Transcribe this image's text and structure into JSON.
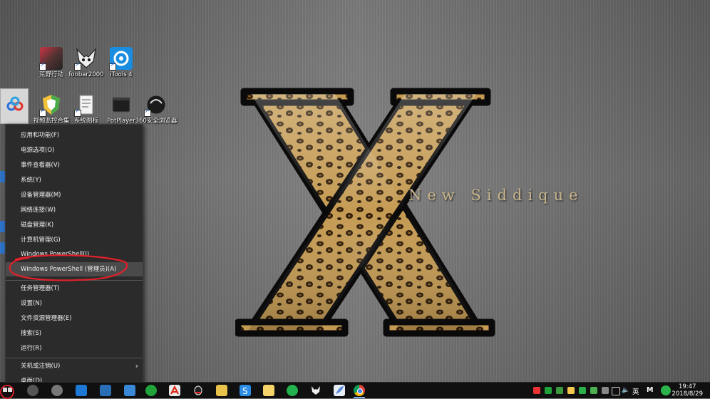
{
  "wallpaper": {
    "text": "New Siddique"
  },
  "desktop_icons": [
    {
      "label": "荒野行动",
      "icon": "game-icon"
    },
    {
      "label": "foobar2000",
      "icon": "foobar-icon"
    },
    {
      "label": "iTools 4",
      "icon": "itools-icon"
    },
    {
      "label": "视频监控合集",
      "icon": "shield-icon"
    },
    {
      "label": "系统图标",
      "icon": "document-icon"
    },
    {
      "label": "PotPlayer",
      "icon": "video-icon"
    },
    {
      "label": "360安全浏览器",
      "icon": "browser-icon"
    }
  ],
  "context_menu": {
    "items": [
      {
        "label": "应用和功能(F)"
      },
      {
        "label": "电源选项(O)"
      },
      {
        "label": "事件查看器(V)"
      },
      {
        "label": "系统(Y)"
      },
      {
        "label": "设备管理器(M)"
      },
      {
        "label": "网络连接(W)"
      },
      {
        "label": "磁盘管理(K)"
      },
      {
        "label": "计算机管理(G)"
      },
      {
        "label": "Windows PowerShell(I)"
      },
      {
        "label": "Windows PowerShell (管理员)(A)"
      },
      {
        "label": "任务管理器(T)"
      },
      {
        "label": "设置(N)"
      },
      {
        "label": "文件资源管理器(E)"
      },
      {
        "label": "搜索(S)"
      },
      {
        "label": "运行(R)"
      },
      {
        "label": "关机或注销(U)"
      },
      {
        "label": "桌面(D)"
      }
    ],
    "highlighted": "Windows PowerShell (管理员)(A)"
  },
  "taskbar": {
    "apps": [
      "wechat-icon",
      "acrobat-icon",
      "qq-icon",
      "yellow-app-icon",
      "sogou-icon",
      "notes-icon",
      "green-refresh-icon",
      "foobar-icon",
      "feather-icon",
      "chrome-icon"
    ],
    "tray": {
      "ime": "英",
      "ime2": "M",
      "time": "19:47",
      "date": "2018/8/29"
    }
  },
  "colors": {
    "menu_bg": "#2b2b2b",
    "highlight": "#4a4a4a",
    "annotation": "#e0202a"
  }
}
